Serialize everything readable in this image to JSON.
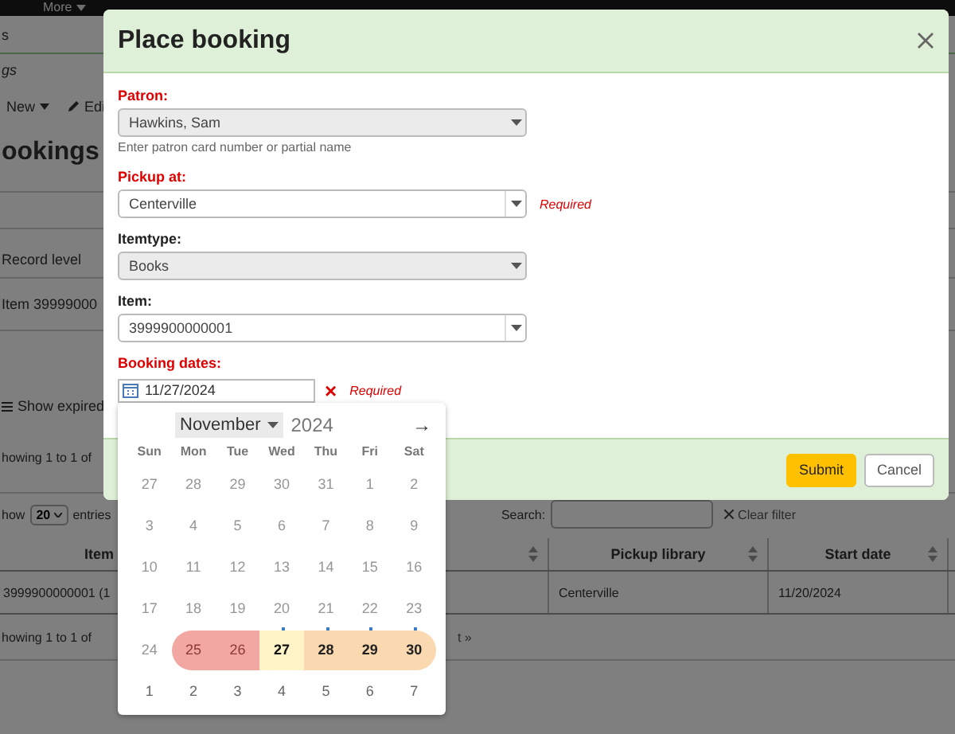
{
  "nav": {
    "items": [
      "More"
    ]
  },
  "breadcrumb": [
    "s",
    "gs"
  ],
  "toolbar": {
    "new": "New",
    "edit": "Edi"
  },
  "heading": "ookings",
  "record_table": {
    "columns": [
      "Record level"
    ],
    "rows": [
      [
        "Item 39999000"
      ]
    ]
  },
  "show_expired": "Show expired",
  "info_top": "howing 1 to 1 of",
  "length": {
    "prefix": "how",
    "value": "20",
    "suffix": "entries"
  },
  "search": {
    "label": "Search:",
    "clear": "Clear filter"
  },
  "bookings_table": {
    "columns": [
      "Item",
      "Pickup library",
      "Start date"
    ],
    "rows": [
      [
        "3999900000001 (1",
        "Centerville",
        "11/20/2024"
      ]
    ]
  },
  "info_bottom": "howing 1 to 1 of",
  "pager": "t »",
  "modal": {
    "title": "Place booking",
    "fields": [
      {
        "label": "Patron:",
        "required": true,
        "value": "Hawkins, Sam",
        "disabled": true,
        "hint": "Enter patron card number or partial name"
      },
      {
        "label": "Pickup at:",
        "required": true,
        "value": "Centerville",
        "disabled": false,
        "error": "Required"
      },
      {
        "label": "Itemtype:",
        "required": false,
        "value": "Books",
        "disabled": true
      },
      {
        "label": "Item:",
        "required": false,
        "value": "3999900000001",
        "disabled": false
      }
    ],
    "dates": {
      "label": "Booking dates:",
      "value": "11/27/2024",
      "clear": "×",
      "error": "Required"
    },
    "buttons": [
      {
        "label": "Submit",
        "kind": "primary"
      },
      {
        "label": "Cancel",
        "kind": "secondary"
      }
    ]
  },
  "calendar": {
    "month": "November",
    "year": "2024",
    "next": "→",
    "weekdays": [
      "Sun",
      "Mon",
      "Tue",
      "Wed",
      "Thu",
      "Fri",
      "Sat"
    ],
    "weeks": [
      [
        {
          "day": "27",
          "kind": "disabled",
          "marked": false
        },
        {
          "day": "28",
          "kind": "disabled",
          "marked": false
        },
        {
          "day": "29",
          "kind": "disabled",
          "marked": false
        },
        {
          "day": "30",
          "kind": "disabled",
          "marked": false
        },
        {
          "day": "31",
          "kind": "disabled",
          "marked": false
        },
        {
          "day": "1",
          "kind": "disabled",
          "marked": false
        },
        {
          "day": "2",
          "kind": "disabled",
          "marked": false
        }
      ],
      [
        {
          "day": "3",
          "kind": "disabled",
          "marked": false
        },
        {
          "day": "4",
          "kind": "disabled",
          "marked": false
        },
        {
          "day": "5",
          "kind": "disabled",
          "marked": false
        },
        {
          "day": "6",
          "kind": "disabled",
          "marked": false
        },
        {
          "day": "7",
          "kind": "disabled",
          "marked": false
        },
        {
          "day": "8",
          "kind": "disabled",
          "marked": false
        },
        {
          "day": "9",
          "kind": "disabled",
          "marked": false
        }
      ],
      [
        {
          "day": "10",
          "kind": "disabled",
          "marked": false
        },
        {
          "day": "11",
          "kind": "disabled",
          "marked": false
        },
        {
          "day": "12",
          "kind": "disabled",
          "marked": false
        },
        {
          "day": "13",
          "kind": "disabled",
          "marked": false
        },
        {
          "day": "14",
          "kind": "disabled",
          "marked": false
        },
        {
          "day": "15",
          "kind": "disabled",
          "marked": false
        },
        {
          "day": "16",
          "kind": "disabled",
          "marked": false
        }
      ],
      [
        {
          "day": "17",
          "kind": "disabled",
          "marked": false
        },
        {
          "day": "18",
          "kind": "disabled",
          "marked": false
        },
        {
          "day": "19",
          "kind": "disabled",
          "marked": false
        },
        {
          "day": "20",
          "kind": "disabled",
          "marked": true
        },
        {
          "day": "21",
          "kind": "disabled",
          "marked": true
        },
        {
          "day": "22",
          "kind": "disabled",
          "marked": true
        },
        {
          "day": "23",
          "kind": "disabled",
          "marked": true
        }
      ],
      [
        {
          "day": "24",
          "kind": "disabled",
          "marked": false
        },
        {
          "day": "25",
          "kind": "booked",
          "marked": false
        },
        {
          "day": "26",
          "kind": "booked",
          "marked": false
        },
        {
          "day": "27",
          "kind": "selected",
          "marked": false
        },
        {
          "day": "28",
          "kind": "range",
          "marked": false
        },
        {
          "day": "29",
          "kind": "range",
          "marked": false
        },
        {
          "day": "30",
          "kind": "range",
          "marked": false
        }
      ],
      [
        {
          "day": "1",
          "kind": "next",
          "marked": false
        },
        {
          "day": "2",
          "kind": "next",
          "marked": false
        },
        {
          "day": "3",
          "kind": "next",
          "marked": false
        },
        {
          "day": "4",
          "kind": "next",
          "marked": false
        },
        {
          "day": "5",
          "kind": "next",
          "marked": false
        },
        {
          "day": "6",
          "kind": "next",
          "marked": false
        },
        {
          "day": "7",
          "kind": "next",
          "marked": false
        }
      ]
    ]
  }
}
